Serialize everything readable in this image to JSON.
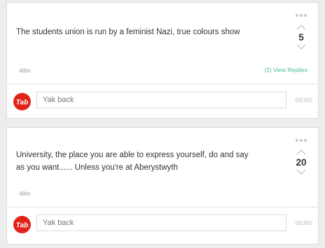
{
  "colors": {
    "background": "#ededed",
    "card": "#ffffff",
    "reply_link": "#4dbd9a",
    "tab_logo_red": "#e2231a"
  },
  "icons": [
    "more-dots-icon",
    "upvote-chevron-icon",
    "downvote-chevron-icon",
    "tab-logo-icon"
  ],
  "posts": [
    {
      "text_lines": [
        "The students union is run by a feminist Nazi, true colours show"
      ],
      "timestamp": "48m",
      "score": "5",
      "replies_label": "(2) View Replies",
      "reply_placeholder": "Yak back",
      "send_label": "SEND",
      "logo_text": "Tab"
    },
    {
      "text_lines": [
        "University, the place you are able to express yourself, do and say",
        "as you want...... Unless you're at Aberystwyth"
      ],
      "timestamp": "48m",
      "score": "20",
      "reply_placeholder": "Yak back",
      "send_label": "SEND",
      "logo_text": "Tab"
    }
  ]
}
